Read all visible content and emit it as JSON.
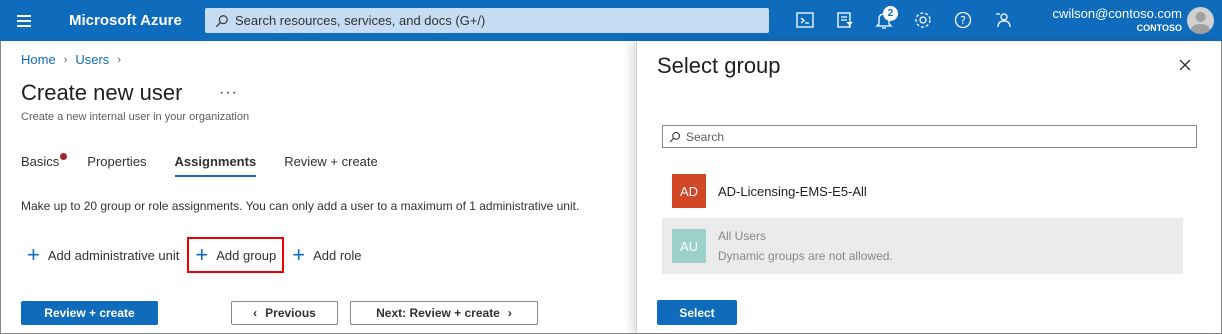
{
  "topbar": {
    "brand": "Microsoft Azure",
    "search_placeholder": "Search resources, services, and docs (G+/)",
    "notification_count": "2",
    "account_email": "cwilson@contoso.com",
    "account_tenant": "CONTOSO",
    "accent_color": "#0f6cbd"
  },
  "breadcrumb": [
    "Home",
    "Users"
  ],
  "page": {
    "title": "Create new user",
    "more": "···",
    "subtitle": "Create a new internal user in your organization",
    "tabs": [
      {
        "label": "Basics",
        "error": true
      },
      {
        "label": "Properties"
      },
      {
        "label": "Assignments",
        "active": true
      },
      {
        "label": "Review + create"
      }
    ],
    "description": "Make up to 20 group or role assignments. You can only add a user to a maximum of 1 administrative unit.",
    "actions": {
      "add_admin_unit": "Add administrative unit",
      "add_group": "Add group",
      "add_role": "Add role"
    },
    "buttons": {
      "review_create": "Review + create",
      "previous": "Previous",
      "next": "Next: Review + create"
    }
  },
  "panel": {
    "title": "Select group",
    "search_placeholder": "Search",
    "groups": [
      {
        "initials": "AD",
        "name": "AD-Licensing-EMS-E5-All",
        "color": "#d24726"
      },
      {
        "initials": "AU",
        "name": "All Users",
        "note": "Dynamic groups are not allowed.",
        "color": "#9cd1cb",
        "disabled": true
      }
    ],
    "select_button": "Select"
  }
}
